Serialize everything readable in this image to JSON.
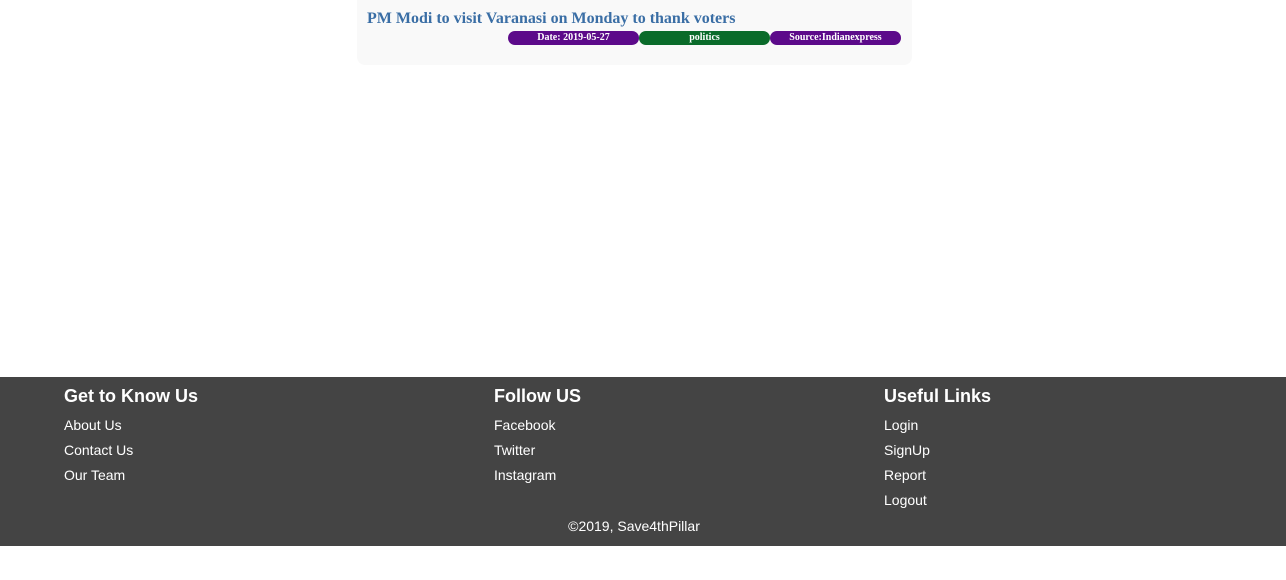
{
  "news": {
    "title": "PM Modi to visit Varanasi on Monday to thank voters",
    "date_badge": "Date: 2019-05-27",
    "category_badge": "politics",
    "source_badge": "Source:Indianexpress",
    "colors": {
      "title": "#3a6ea5",
      "date_badge": "#5c0a8a",
      "category_badge": "#0a6b2a",
      "source_badge": "#5c0a8a"
    }
  },
  "footer": {
    "background": "#444444",
    "columns": [
      {
        "heading": "Get to Know Us",
        "links": [
          "About Us",
          "Contact Us",
          "Our Team"
        ]
      },
      {
        "heading": "Follow US",
        "links": [
          "Facebook",
          "Twitter",
          "Instagram"
        ]
      },
      {
        "heading": "Useful Links",
        "links": [
          "Login",
          "SignUp",
          "Report",
          "Logout"
        ]
      }
    ],
    "copyright": "©2019, Save4thPillar"
  }
}
